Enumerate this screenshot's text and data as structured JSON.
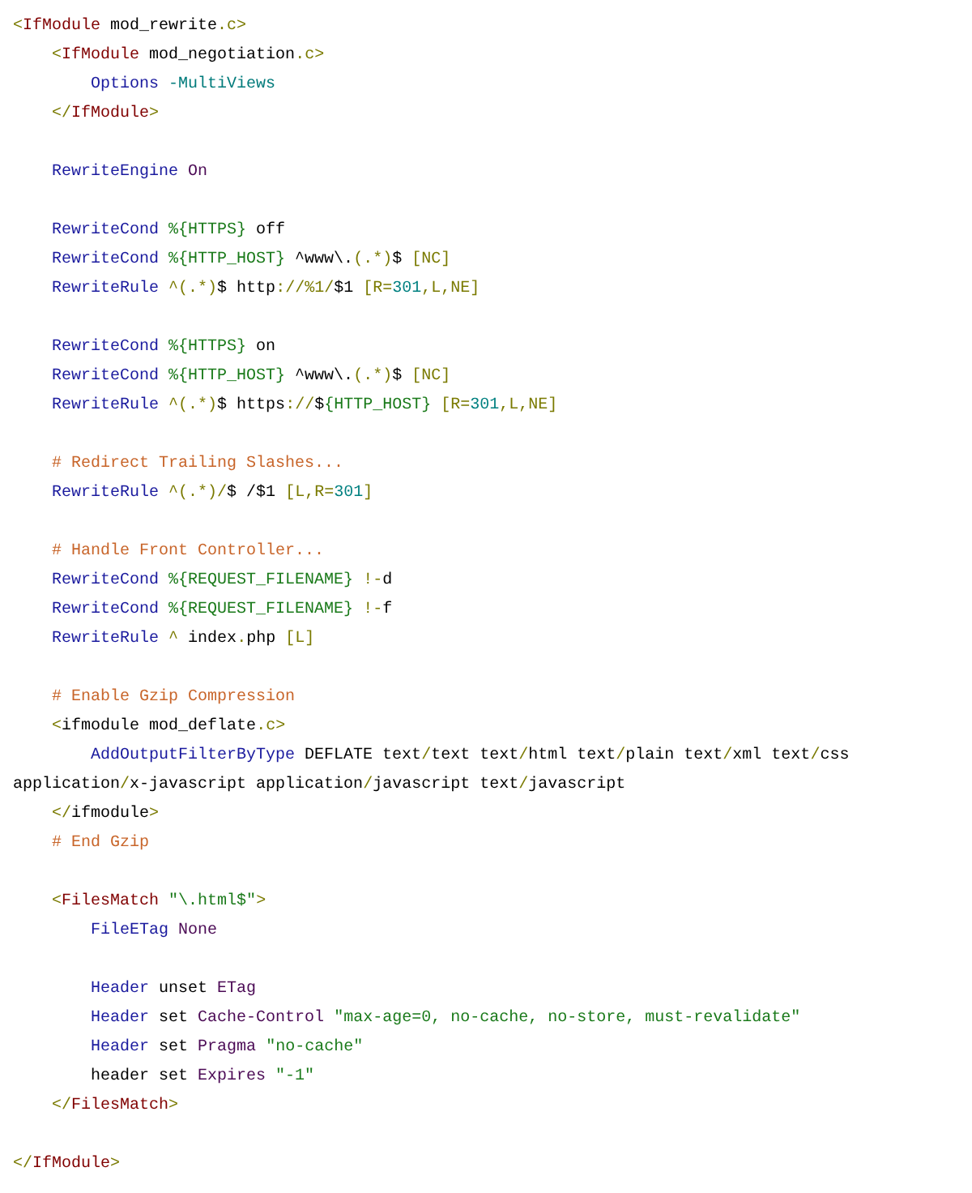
{
  "code_blocks": [
    {
      "lines": [
        {
          "tokens": [
            {
              "kind": "punct",
              "text": "<"
            },
            {
              "kind": "tag",
              "text": "IfModule"
            },
            {
              "kind": "plain",
              "text": " mod_rewrite"
            },
            {
              "kind": "punct",
              "text": ".c>"
            }
          ]
        },
        {
          "tokens": [
            {
              "kind": "punct",
              "text": "    <"
            },
            {
              "kind": "tag",
              "text": "IfModule"
            },
            {
              "kind": "plain",
              "text": " mod_negotiation"
            },
            {
              "kind": "punct",
              "text": ".c>"
            }
          ]
        },
        {
          "tokens": [
            {
              "kind": "directive",
              "text": "        Options"
            },
            {
              "kind": "flag",
              "text": " -MultiViews"
            }
          ]
        },
        {
          "tokens": [
            {
              "kind": "punct",
              "text": "    </"
            },
            {
              "kind": "tag",
              "text": "IfModule"
            },
            {
              "kind": "punct",
              "text": ">"
            }
          ]
        }
      ]
    },
    {
      "lines": [
        {
          "tokens": [
            {
              "kind": "directive",
              "text": "    RewriteEngine"
            },
            {
              "kind": "value",
              "text": " On"
            }
          ]
        }
      ]
    },
    {
      "lines": [
        {
          "tokens": [
            {
              "kind": "directive",
              "text": "    RewriteCond"
            },
            {
              "kind": "variable",
              "text": " %{HTTPS}"
            },
            {
              "kind": "plain",
              "text": " off"
            }
          ]
        },
        {
          "tokens": [
            {
              "kind": "directive",
              "text": "    RewriteCond"
            },
            {
              "kind": "variable",
              "text": " %{HTTP_HOST}"
            },
            {
              "kind": "plain",
              "text": " ^www\\."
            },
            {
              "kind": "punct",
              "text": "(.*)"
            },
            {
              "kind": "plain",
              "text": "$ "
            },
            {
              "kind": "punct",
              "text": "[NC]"
            }
          ]
        },
        {
          "tokens": [
            {
              "kind": "directive",
              "text": "    RewriteRule"
            },
            {
              "kind": "punct",
              "text": " ^(.*)"
            },
            {
              "kind": "plain",
              "text": "$ http"
            },
            {
              "kind": "punct",
              "text": "://%1/"
            },
            {
              "kind": "plain",
              "text": "$1 "
            },
            {
              "kind": "punct",
              "text": "[R="
            },
            {
              "kind": "number",
              "text": "301"
            },
            {
              "kind": "punct",
              "text": ",L,NE]"
            }
          ]
        }
      ]
    },
    {
      "lines": [
        {
          "tokens": [
            {
              "kind": "directive",
              "text": "    RewriteCond"
            },
            {
              "kind": "variable",
              "text": " %{HTTPS}"
            },
            {
              "kind": "plain",
              "text": " on"
            }
          ]
        },
        {
          "tokens": [
            {
              "kind": "directive",
              "text": "    RewriteCond"
            },
            {
              "kind": "variable",
              "text": " %{HTTP_HOST}"
            },
            {
              "kind": "plain",
              "text": " ^www\\."
            },
            {
              "kind": "punct",
              "text": "(.*)"
            },
            {
              "kind": "plain",
              "text": "$ "
            },
            {
              "kind": "punct",
              "text": "[NC]"
            }
          ]
        },
        {
          "tokens": [
            {
              "kind": "directive",
              "text": "    RewriteRule"
            },
            {
              "kind": "punct",
              "text": " ^(.*)"
            },
            {
              "kind": "plain",
              "text": "$ https"
            },
            {
              "kind": "punct",
              "text": "://"
            },
            {
              "kind": "plain",
              "text": "$"
            },
            {
              "kind": "variable",
              "text": "{HTTP_HOST}"
            },
            {
              "kind": "punct",
              "text": " [R="
            },
            {
              "kind": "number",
              "text": "301"
            },
            {
              "kind": "punct",
              "text": ",L,NE]"
            }
          ]
        }
      ]
    },
    {
      "lines": [
        {
          "tokens": [
            {
              "kind": "comment",
              "text": "    # Redirect Trailing Slashes..."
            }
          ]
        },
        {
          "tokens": [
            {
              "kind": "directive",
              "text": "    RewriteRule"
            },
            {
              "kind": "punct",
              "text": " ^(.*)/"
            },
            {
              "kind": "plain",
              "text": "$ /$1 "
            },
            {
              "kind": "punct",
              "text": "[L,R="
            },
            {
              "kind": "number",
              "text": "301"
            },
            {
              "kind": "punct",
              "text": "]"
            }
          ]
        }
      ]
    },
    {
      "lines": [
        {
          "tokens": [
            {
              "kind": "comment",
              "text": "    # Handle Front Controller..."
            }
          ]
        },
        {
          "tokens": [
            {
              "kind": "directive",
              "text": "    RewriteCond"
            },
            {
              "kind": "variable",
              "text": " %{REQUEST_FILENAME}"
            },
            {
              "kind": "punct",
              "text": " !-"
            },
            {
              "kind": "plain",
              "text": "d"
            }
          ]
        },
        {
          "tokens": [
            {
              "kind": "directive",
              "text": "    RewriteCond"
            },
            {
              "kind": "variable",
              "text": " %{REQUEST_FILENAME}"
            },
            {
              "kind": "punct",
              "text": " !-"
            },
            {
              "kind": "plain",
              "text": "f"
            }
          ]
        },
        {
          "tokens": [
            {
              "kind": "directive",
              "text": "    RewriteRule"
            },
            {
              "kind": "punct",
              "text": " ^"
            },
            {
              "kind": "plain",
              "text": " index"
            },
            {
              "kind": "punct",
              "text": "."
            },
            {
              "kind": "plain",
              "text": "php "
            },
            {
              "kind": "punct",
              "text": "[L]"
            }
          ]
        }
      ]
    },
    {
      "lines": [
        {
          "tokens": [
            {
              "kind": "comment",
              "text": "    # Enable Gzip Compression"
            }
          ]
        },
        {
          "tokens": [
            {
              "kind": "punct",
              "text": "    <"
            },
            {
              "kind": "plain",
              "text": "ifmodule mod_deflate"
            },
            {
              "kind": "punct",
              "text": ".c>"
            }
          ]
        },
        {
          "tokens": [
            {
              "kind": "directive",
              "text": "        AddOutputFilterByType"
            },
            {
              "kind": "plain",
              "text": " DEFLATE text"
            },
            {
              "kind": "punct",
              "text": "/"
            },
            {
              "kind": "plain",
              "text": "text text"
            },
            {
              "kind": "punct",
              "text": "/"
            },
            {
              "kind": "plain",
              "text": "html text"
            },
            {
              "kind": "punct",
              "text": "/"
            },
            {
              "kind": "plain",
              "text": "plain text"
            },
            {
              "kind": "punct",
              "text": "/"
            },
            {
              "kind": "plain",
              "text": "xml text"
            },
            {
              "kind": "punct",
              "text": "/"
            },
            {
              "kind": "plain",
              "text": "css application"
            },
            {
              "kind": "punct",
              "text": "/"
            },
            {
              "kind": "plain",
              "text": "x-javascript application"
            },
            {
              "kind": "punct",
              "text": "/"
            },
            {
              "kind": "plain",
              "text": "javascript text"
            },
            {
              "kind": "punct",
              "text": "/"
            },
            {
              "kind": "plain",
              "text": "javascript"
            }
          ]
        },
        {
          "tokens": [
            {
              "kind": "punct",
              "text": "    </"
            },
            {
              "kind": "plain",
              "text": "ifmodule"
            },
            {
              "kind": "punct",
              "text": ">"
            }
          ]
        },
        {
          "tokens": [
            {
              "kind": "comment",
              "text": "    # End Gzip"
            }
          ]
        }
      ]
    },
    {
      "lines": [
        {
          "tokens": [
            {
              "kind": "punct",
              "text": "    <"
            },
            {
              "kind": "tag",
              "text": "FilesMatch"
            },
            {
              "kind": "string",
              "text": " \"\\.html$\""
            },
            {
              "kind": "punct",
              "text": ">"
            }
          ]
        },
        {
          "tokens": [
            {
              "kind": "directive",
              "text": "        FileETag"
            },
            {
              "kind": "value",
              "text": " None"
            }
          ]
        }
      ]
    },
    {
      "lines": [
        {
          "tokens": [
            {
              "kind": "directive",
              "text": "        Header"
            },
            {
              "kind": "plain",
              "text": " unset"
            },
            {
              "kind": "value",
              "text": " ETag"
            }
          ]
        },
        {
          "tokens": [
            {
              "kind": "directive",
              "text": "        Header"
            },
            {
              "kind": "plain",
              "text": " set"
            },
            {
              "kind": "value",
              "text": " Cache-Control"
            },
            {
              "kind": "string",
              "text": " \"max-age=0, no-cache, no-store, must-revalidate\""
            }
          ]
        },
        {
          "tokens": [
            {
              "kind": "directive",
              "text": "        Header"
            },
            {
              "kind": "plain",
              "text": " set"
            },
            {
              "kind": "value",
              "text": " Pragma"
            },
            {
              "kind": "string",
              "text": " \"no-cache\""
            }
          ]
        },
        {
          "tokens": [
            {
              "kind": "plain",
              "text": "        header set"
            },
            {
              "kind": "value",
              "text": " Expires"
            },
            {
              "kind": "string",
              "text": " \"-1\""
            }
          ]
        },
        {
          "tokens": [
            {
              "kind": "punct",
              "text": "    </"
            },
            {
              "kind": "tag",
              "text": "FilesMatch"
            },
            {
              "kind": "punct",
              "text": ">"
            }
          ]
        }
      ]
    },
    {
      "lines": [
        {
          "tokens": [
            {
              "kind": "punct",
              "text": "</"
            },
            {
              "kind": "tag",
              "text": "IfModule"
            },
            {
              "kind": "punct",
              "text": ">"
            }
          ]
        }
      ]
    }
  ]
}
